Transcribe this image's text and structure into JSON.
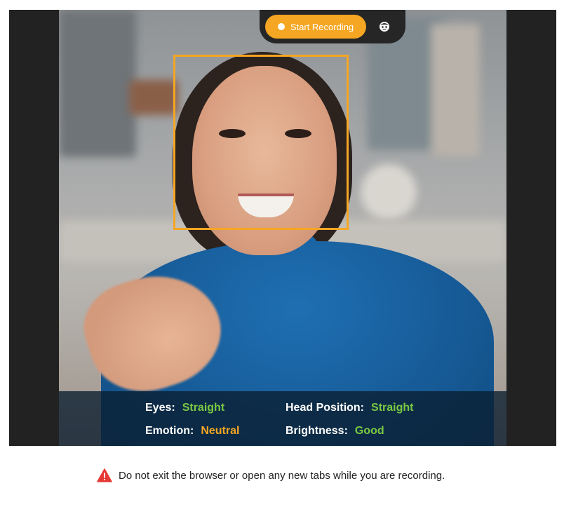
{
  "toolbar": {
    "record_label": "Start Recording",
    "record_dot_icon": "record-dot-icon",
    "face_icon": "face-detect-icon"
  },
  "status": {
    "eyes_label": "Eyes:",
    "eyes_value": "Straight",
    "head_label": "Head Position:",
    "head_value": "Straight",
    "emotion_label": "Emotion:",
    "emotion_value": "Neutral",
    "brightness_label": "Brightness:",
    "brightness_value": "Good"
  },
  "notice": {
    "icon": "warning-icon",
    "text": "Do not exit the browser or open any new tabs while you are recording."
  },
  "colors": {
    "accent": "#f5a623",
    "good": "#7ac943",
    "warning": "#e53935",
    "frame": "#222222"
  }
}
